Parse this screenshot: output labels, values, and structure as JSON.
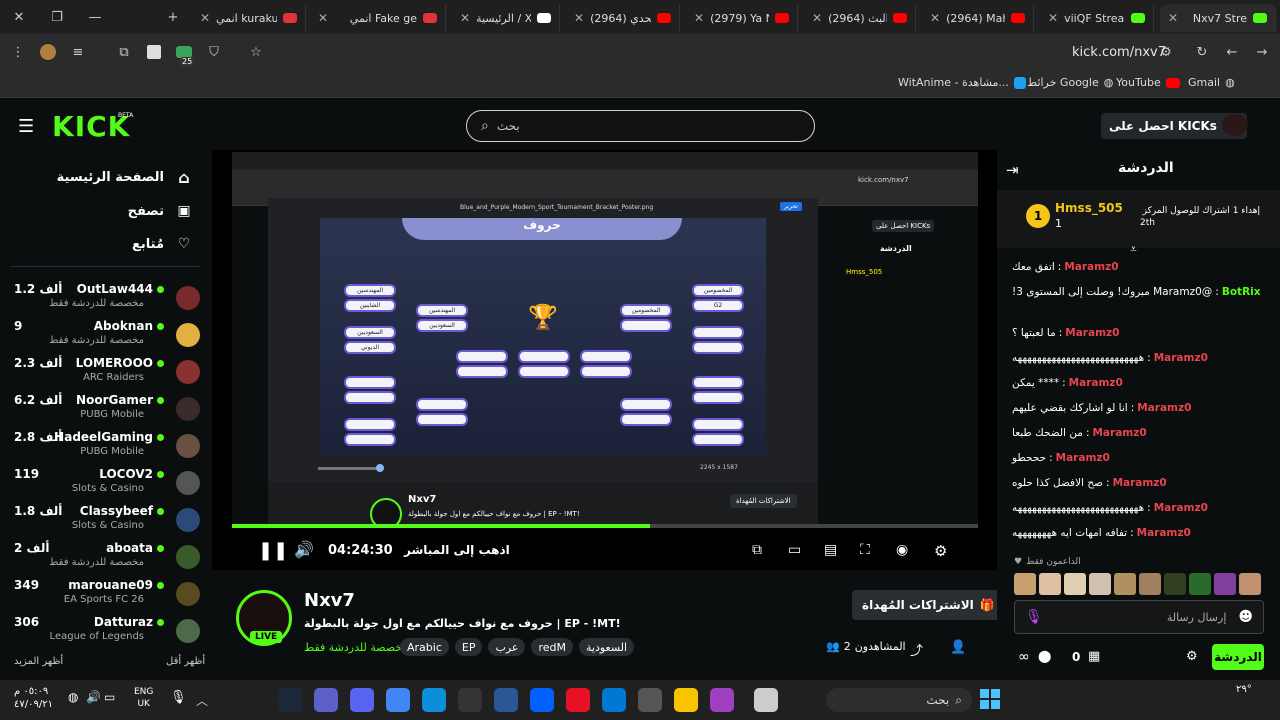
{
  "browser": {
    "tabs": [
      {
        "title": "انمي kuraku",
        "favicon_color": "#e0333a"
      },
      {
        "title": "انمي Fake ge",
        "favicon_color": "#e0333a"
      },
      {
        "title": "الرئيسية / X",
        "favicon_color": "#ffffff"
      },
      {
        "title": "(2964) تحدي",
        "favicon_color": "#ff0000"
      },
      {
        "title": "(2979) Ya Na",
        "favicon_color": "#ff0000"
      },
      {
        "title": "(2964) البث",
        "favicon_color": "#ff0000"
      },
      {
        "title": "(2964) Maher",
        "favicon_color": "#ff0000"
      },
      {
        "title": "viiQF Stream",
        "favicon_color": "#53fc18"
      },
      {
        "title": "Nxv7 Stre",
        "favicon_color": "#53fc18"
      }
    ],
    "url": "kick.com/nxv7",
    "extension_badge": "25",
    "bookmarks": [
      {
        "label": "Gmail",
        "icon": "globe-icon"
      },
      {
        "label": "YouTube",
        "icon": "youtube-icon"
      },
      {
        "label": "خرائط Google",
        "icon": "globe-icon"
      },
      {
        "label": "WitAnime - مشاهدة...",
        "icon": "w-icon"
      }
    ]
  },
  "header": {
    "logo": "KICK",
    "logo_badge": "BETA",
    "search_placeholder": "بحث",
    "get_kicks": "احصل على KICKs"
  },
  "sidebar": {
    "nav": [
      {
        "label": "الصفحة الرئيسية",
        "icon": "home-icon"
      },
      {
        "label": "تصفح",
        "icon": "browse-icon"
      },
      {
        "label": "مُتابع",
        "icon": "heart-icon"
      }
    ],
    "following": [
      {
        "name": "OutLaw444",
        "category": "مخصصة للدردشة فقط",
        "viewers": "1.2 ألف",
        "avatar_color": "#7a2a2a"
      },
      {
        "name": "Aboknan",
        "category": "مخصصة للدردشة فقط",
        "viewers": "9",
        "avatar_color": "#e0b040"
      },
      {
        "name": "LOMEROOO",
        "category": "ARC Raiders",
        "viewers": "2.3 ألف",
        "avatar_color": "#8a3030"
      },
      {
        "name": "NoorGamer",
        "category": "PUBG Mobile",
        "viewers": "6.2 ألف",
        "avatar_color": "#3a2a2a"
      },
      {
        "name": "HadeelGaming",
        "category": "PUBG Mobile",
        "viewers": "2.8 ألف",
        "avatar_color": "#6a5040"
      },
      {
        "name": "LOCOV2",
        "category": "Slots & Casino",
        "viewers": "119",
        "avatar_color": "#555555"
      },
      {
        "name": "Classybeef",
        "category": "Slots & Casino",
        "viewers": "1.8 ألف",
        "avatar_color": "#2a4a7a"
      },
      {
        "name": "aboata",
        "category": "مخصصة للدردشة فقط",
        "viewers": "2 ألف",
        "avatar_color": "#3a5a2a"
      },
      {
        "name": "marouane09",
        "category": "EA Sports FC 26",
        "viewers": "349",
        "avatar_color": "#5a4a20"
      },
      {
        "name": "Datturaz",
        "category": "League of Legends",
        "viewers": "306",
        "avatar_color": "#4a6a4a"
      }
    ],
    "show_more": "أظهر المزيد",
    "show_less": "أظهر أقل"
  },
  "player": {
    "time": "04:24:30",
    "go_live": "اذهب إلى المباشر",
    "progress": 0.56,
    "inner_title": "Blue_and_Purple_Modern_Sport_Tournament_Bracket_Poster.png",
    "bracket_title": "حروف",
    "left_teams": [
      "المهندسين",
      "الشايبين",
      "السعوديين",
      "الديوني"
    ],
    "mid_teams": [
      "المهندسين",
      "السعوديين"
    ],
    "right_teams": [
      "المخصومين",
      "G2"
    ],
    "right_mid": [
      "المخصومين"
    ],
    "inner_zoom": "2245 x 1587"
  },
  "stream": {
    "streamer": "Nxv7",
    "title": "حروف مع نواف حييالكم مع اول جولة بالبطولة | EP - !MT!",
    "category": "مخصصة للدردشة فقط",
    "tags": [
      "Arabic",
      "EP",
      "عرب",
      "redM",
      "السعودية"
    ],
    "live_label": "LIVE",
    "gift_subs": "الاشتراكات المُهداة",
    "viewers_label": "المشاهدون",
    "viewers_count": "2"
  },
  "chat": {
    "title": "الدردشة",
    "pinned_user": "Hmss_505",
    "pinned_count": "1",
    "pinned_text": "إهداء 1 اشتراك للوصول المركز",
    "pinned_rank": "2th",
    "messages": [
      {
        "user": "Maramz0",
        "text": "اتفق معك",
        "color": "#e9454e"
      },
      {
        "user": "BotRix",
        "text": "@Maramz0 مبروك! وصلت إلى المستوى 3!",
        "color": "#53fc18"
      },
      {
        "user": "Maramz0",
        "text": "ما لعبتها ؟",
        "color": "#e9454e"
      },
      {
        "user": "Maramz0",
        "text": "ههههههههههههههههههههههههههه",
        "color": "#e9454e"
      },
      {
        "user": "Maramz0",
        "text": "**** يمكن",
        "color": "#e9454e"
      },
      {
        "user": "Maramz0",
        "text": "انا لو اشاركك بقضي عليهم",
        "color": "#e9454e"
      },
      {
        "user": "Maramz0",
        "text": "من الضحك طبعا",
        "color": "#e9454e"
      },
      {
        "user": "Maramz0",
        "text": "حححطو",
        "color": "#e9454e"
      },
      {
        "user": "Maramz0",
        "text": "صح الافضل كذا حلوه",
        "color": "#e9454e"
      },
      {
        "user": "Maramz0",
        "text": "ههههههههههههههههههههههههههه",
        "color": "#e9454e"
      },
      {
        "user": "Maramz0",
        "text": "تفافه امهات ايه ههههههههه",
        "color": "#e9454e"
      }
    ],
    "supporters_label": "الداعمون فقط",
    "input_placeholder": "إرسال رسالة",
    "send_label": "الدردشة",
    "points": "0"
  },
  "taskbar": {
    "search": "بحث",
    "time": "٠٥:٠٩ م",
    "date": "٤٧/٠٩/٢١",
    "lang": "ENG",
    "lang2": "UK",
    "temp": "٢٩°"
  }
}
